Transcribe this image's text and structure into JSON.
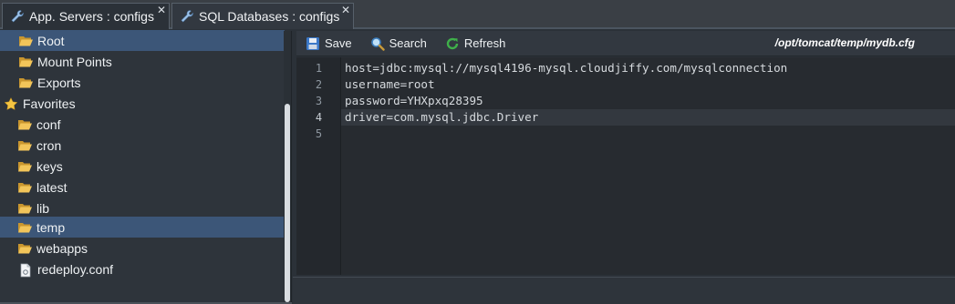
{
  "tabs": [
    {
      "label": "App. Servers : configs",
      "icon": "wrench-icon",
      "active": true
    },
    {
      "label": "SQL Databases : configs",
      "icon": "wrench-icon",
      "active": false
    }
  ],
  "tree": {
    "items": [
      {
        "label": "Root",
        "icon": "folder-icon",
        "selected": true
      },
      {
        "label": "Mount Points",
        "icon": "folder-icon"
      },
      {
        "label": "Exports",
        "icon": "folder-icon"
      },
      {
        "label": "Favorites",
        "icon": "star-icon"
      },
      {
        "label": "conf",
        "icon": "folder-icon"
      },
      {
        "label": "cron",
        "icon": "folder-icon"
      },
      {
        "label": "keys",
        "icon": "folder-icon"
      },
      {
        "label": "latest",
        "icon": "folder-icon"
      },
      {
        "label": "lib",
        "icon": "folder-icon"
      },
      {
        "label": "temp",
        "icon": "folder-icon",
        "selected": true
      },
      {
        "label": "webapps",
        "icon": "folder-icon"
      },
      {
        "label": "redeploy.conf",
        "icon": "file-icon"
      }
    ]
  },
  "toolbar": {
    "save_label": "Save",
    "search_label": "Search",
    "refresh_label": "Refresh",
    "file_path": "/opt/tomcat/temp/mydb.cfg"
  },
  "editor": {
    "line_numbers": [
      "1",
      "2",
      "3",
      "4",
      "5"
    ],
    "lines": [
      "host=jdbc:mysql://mysql4196-mysql.cloudjiffy.com/mysqlconnection",
      "username=root",
      "password=YHXpxq28395",
      "driver=com.mysql.jdbc.Driver",
      ""
    ],
    "active_line": 4
  },
  "colors": {
    "selected_row": "#3c5678",
    "folder": "#e8b84a",
    "refresh_green": "#3fb04a",
    "save_blue": "#3b78c8"
  }
}
